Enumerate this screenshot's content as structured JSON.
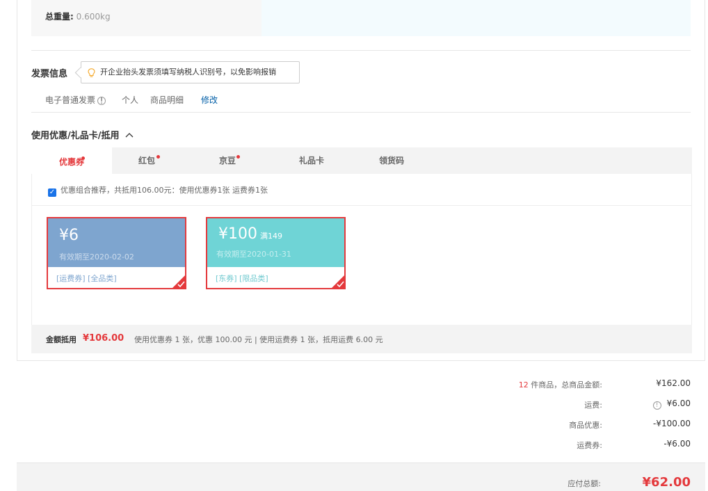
{
  "weight": {
    "label": "总重量:",
    "value": "0.600kg"
  },
  "invoice": {
    "title": "发票信息",
    "tooltip": "开企业抬头发票须填写纳税人识别号，以免影响报销",
    "type": "电子普通发票",
    "info_icon": "!",
    "holder": "个人",
    "content": "商品明细",
    "edit_label": "修改"
  },
  "discount": {
    "title": "使用优惠/礼品卡/抵用",
    "tabs": [
      {
        "label": "优惠券",
        "dot": true
      },
      {
        "label": "红包",
        "dot": true
      },
      {
        "label": "京豆",
        "dot": true
      },
      {
        "label": "礼品卡",
        "dot": false
      },
      {
        "label": "领货码",
        "dot": false
      }
    ],
    "recommend": "优惠组合推荐，共抵用106.00元：使用优惠券1张 运费券1张",
    "coupons": [
      {
        "amount": "¥6",
        "condition": "",
        "expiry": "有效期至2020-02-02",
        "tags": "[运费券]  [全品类]",
        "color": "#7ea5cf",
        "tag_color": "#7ea5cf"
      },
      {
        "amount": "¥100",
        "condition": "满149",
        "expiry": "有效期至2020-01-31",
        "tags": "[东券]  [限品类]",
        "color": "#6fd4d6",
        "tag_color": "#6fc9cf"
      }
    ],
    "summary": {
      "label": "金额抵用",
      "amount": "¥106.00",
      "desc": "使用优惠券 1 张，优惠 100.00 元   | 使用运费券 1 张，抵用运费 6.00 元"
    }
  },
  "totals": {
    "count": "12",
    "count_suffix": " 件商品，总商品金额:",
    "goods_total": "¥162.00",
    "shipping_label": "运费:",
    "shipping": "¥6.00",
    "promo_label": "商品优惠:",
    "promo": "-¥100.00",
    "ship_coupon_label": "运费券:",
    "ship_coupon": "-¥6.00",
    "payable_label": "应付总额:",
    "payable": "¥62.00"
  },
  "colors": {
    "accent": "#e4393c",
    "orange": "#ff6600",
    "link": "#005ea7"
  }
}
